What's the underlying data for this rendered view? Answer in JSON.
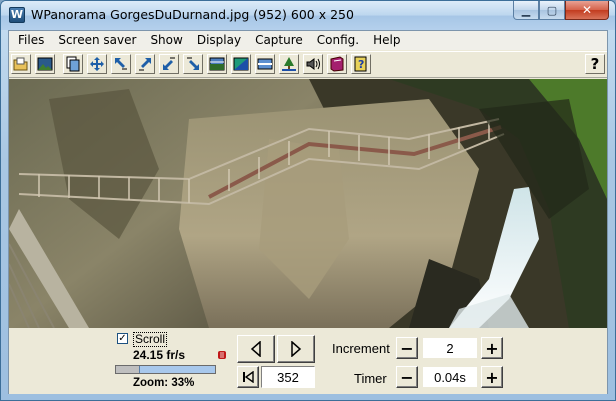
{
  "window": {
    "icon_letter": "W",
    "title": "WPanorama  GorgesDuDurnand.jpg  (952) 600 x 250",
    "min_glyph": "▁",
    "max_glyph": "▢",
    "close_glyph": "✕"
  },
  "menu": [
    "Files",
    "Screen saver",
    "Show",
    "Display",
    "Capture",
    "Config.",
    "Help"
  ],
  "toolbar": {
    "help_glyph": "?",
    "icons": [
      "open-file-icon",
      "picture-icon",
      "copy-icon",
      "fit-icon",
      "arrows-nw-icon",
      "arrows-ne-icon",
      "arrows-sw-icon",
      "arrows-se-icon",
      "landscape-icon",
      "gradient-icon",
      "strip-icon",
      "tree-icon",
      "speaker-icon",
      "book-icon",
      "help-doc-icon",
      "help-icon"
    ]
  },
  "controls": {
    "scroll_checked": "✓",
    "scroll_label": "Scroll",
    "fps": "24.15 fr/s",
    "zoom_label": "Zoom: 33%",
    "zoom_fraction": 0.33,
    "position": "352",
    "increment_label": "Increment",
    "increment_value": "2",
    "timer_label": "Timer",
    "timer_value": "0.04s",
    "minus": "−",
    "plus": "+"
  }
}
